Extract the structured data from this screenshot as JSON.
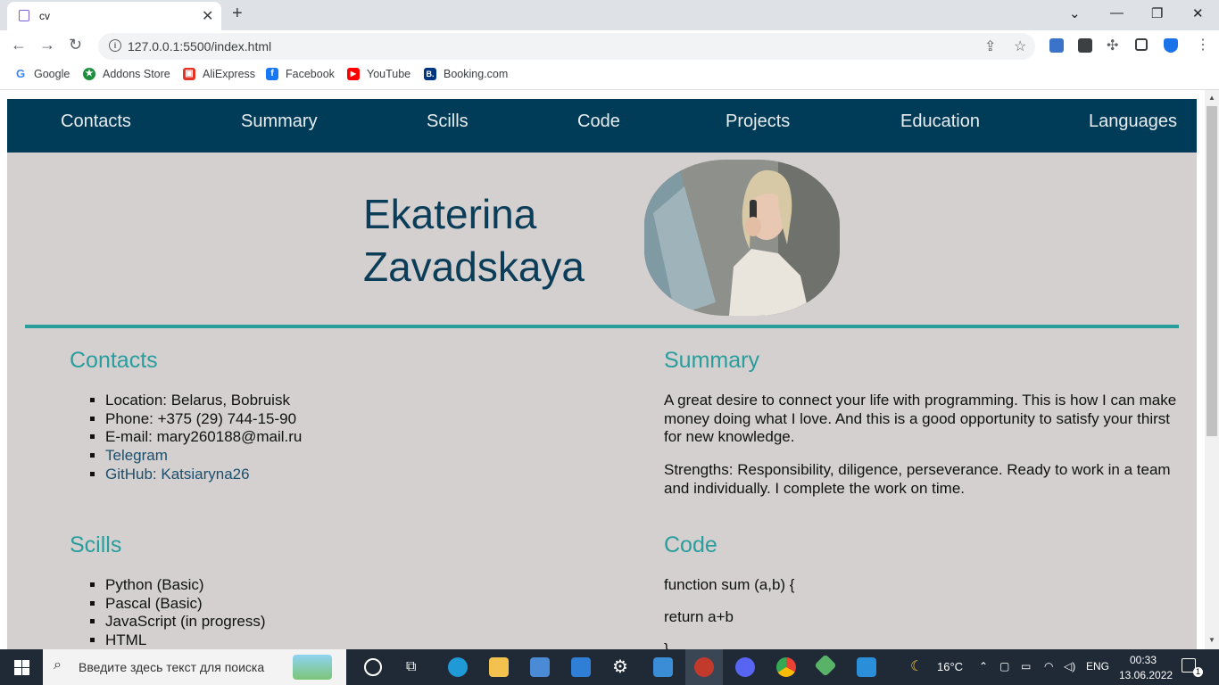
{
  "browser": {
    "tab_title": "cv",
    "tab_close": "✕",
    "new_tab": "+",
    "url": "127.0.0.1:5500/index.html",
    "bookmarks": [
      {
        "label": "Google",
        "icon": "google-icon",
        "color": "#4285f4",
        "glyph": "G"
      },
      {
        "label": "Addons Store",
        "icon": "addons-store-icon",
        "color": "#1e8e3e",
        "glyph": "★"
      },
      {
        "label": "AliExpress",
        "icon": "aliexpress-icon",
        "color": "#e43225",
        "glyph": "▣"
      },
      {
        "label": "Facebook",
        "icon": "facebook-icon",
        "color": "#1877f2",
        "glyph": "f"
      },
      {
        "label": "YouTube",
        "icon": "youtube-icon",
        "color": "#ff0000",
        "glyph": "▶"
      },
      {
        "label": "Booking.com",
        "icon": "booking-icon",
        "color": "#003580",
        "glyph": "B."
      }
    ]
  },
  "nav": {
    "items": [
      "Contacts",
      "Summary",
      "Scills",
      "Code",
      "Projects",
      "Education",
      "Languages"
    ]
  },
  "header": {
    "first_name": "Ekaterina",
    "last_name": "Zavadskaya"
  },
  "contacts": {
    "title": "Contacts",
    "items": [
      "Location: Belarus, Bobruisk",
      "Phone: +375 (29) 744-15-90",
      "E-mail: mary260188@mail.ru",
      "Telegram",
      "GitHub: Katsiaryna26"
    ]
  },
  "summary": {
    "title": "Summary",
    "paragraphs": [
      "A great desire to connect your life with programming. This is how I can make money doing what I love. And this is a good opportunity to satisfy your thirst for new knowledge.",
      "Strengths: Responsibility, diligence, perseverance. Ready to work in a team and individually. I complete the work on time."
    ]
  },
  "scills": {
    "title": "Scills",
    "items": [
      "Python (Basic)",
      "Pascal (Basic)",
      "JavaScript (in progress)",
      "HTML"
    ]
  },
  "code": {
    "title": "Code",
    "lines": [
      "function sum (a,b) {",
      "return a+b",
      "}"
    ]
  },
  "taskbar": {
    "search_placeholder": "Введите здесь текст для поиска",
    "weather": "16°C",
    "language": "ENG",
    "time": "00:33",
    "date": "13.06.2022",
    "notifications": "1"
  },
  "colors": {
    "nav_bg": "#003b57",
    "page_bg": "#d4d0d0",
    "accent": "#2a9d9d",
    "name_color": "#0b3d59"
  }
}
